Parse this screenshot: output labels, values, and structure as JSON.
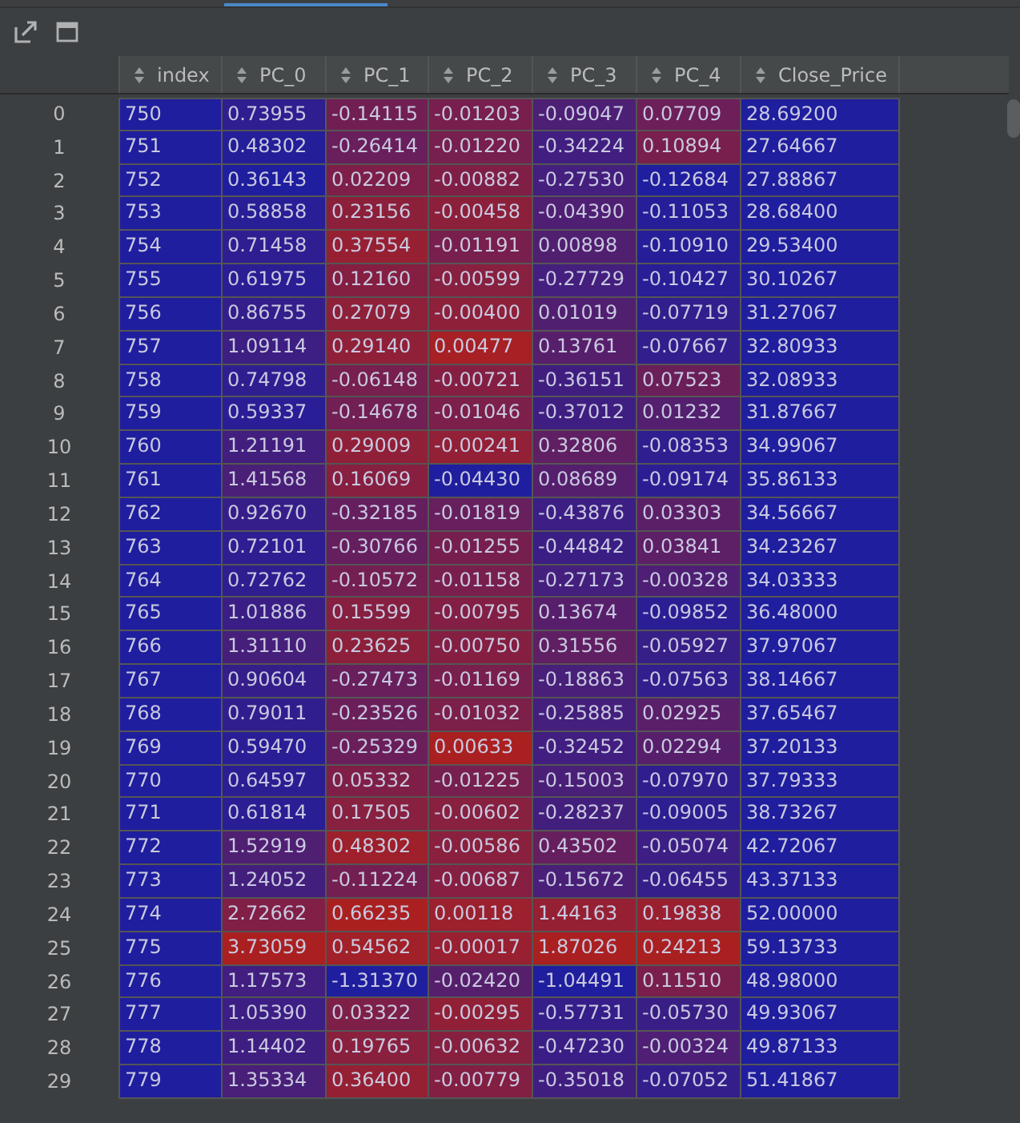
{
  "columns": [
    {
      "label": "index",
      "heatmap": false
    },
    {
      "label": "PC_0",
      "heatmap": true
    },
    {
      "label": "PC_1",
      "heatmap": true
    },
    {
      "label": "PC_2",
      "heatmap": true
    },
    {
      "label": "PC_3",
      "heatmap": true
    },
    {
      "label": "PC_4",
      "heatmap": true
    },
    {
      "label": "Close_Price",
      "heatmap": false
    }
  ],
  "rows": [
    {
      "label": "0",
      "cells": [
        "750",
        "0.73955",
        "-0.14115",
        "-0.01203",
        "-0.09047",
        "0.07709",
        "28.69200"
      ]
    },
    {
      "label": "1",
      "cells": [
        "751",
        "0.48302",
        "-0.26414",
        "-0.01220",
        "-0.34224",
        "0.10894",
        "27.64667"
      ]
    },
    {
      "label": "2",
      "cells": [
        "752",
        "0.36143",
        "0.02209",
        "-0.00882",
        "-0.27530",
        "-0.12684",
        "27.88867"
      ]
    },
    {
      "label": "3",
      "cells": [
        "753",
        "0.58858",
        "0.23156",
        "-0.00458",
        "-0.04390",
        "-0.11053",
        "28.68400"
      ]
    },
    {
      "label": "4",
      "cells": [
        "754",
        "0.71458",
        "0.37554",
        "-0.01191",
        "0.00898",
        "-0.10910",
        "29.53400"
      ]
    },
    {
      "label": "5",
      "cells": [
        "755",
        "0.61975",
        "0.12160",
        "-0.00599",
        "-0.27729",
        "-0.10427",
        "30.10267"
      ]
    },
    {
      "label": "6",
      "cells": [
        "756",
        "0.86755",
        "0.27079",
        "-0.00400",
        "0.01019",
        "-0.07719",
        "31.27067"
      ]
    },
    {
      "label": "7",
      "cells": [
        "757",
        "1.09114",
        "0.29140",
        "0.00477",
        "0.13761",
        "-0.07667",
        "32.80933"
      ]
    },
    {
      "label": "8",
      "cells": [
        "758",
        "0.74798",
        "-0.06148",
        "-0.00721",
        "-0.36151",
        "0.07523",
        "32.08933"
      ]
    },
    {
      "label": "9",
      "cells": [
        "759",
        "0.59337",
        "-0.14678",
        "-0.01046",
        "-0.37012",
        "0.01232",
        "31.87667"
      ]
    },
    {
      "label": "10",
      "cells": [
        "760",
        "1.21191",
        "0.29009",
        "-0.00241",
        "0.32806",
        "-0.08353",
        "34.99067"
      ]
    },
    {
      "label": "11",
      "cells": [
        "761",
        "1.41568",
        "0.16069",
        "-0.04430",
        "0.08689",
        "-0.09174",
        "35.86133"
      ]
    },
    {
      "label": "12",
      "cells": [
        "762",
        "0.92670",
        "-0.32185",
        "-0.01819",
        "-0.43876",
        "0.03303",
        "34.56667"
      ]
    },
    {
      "label": "13",
      "cells": [
        "763",
        "0.72101",
        "-0.30766",
        "-0.01255",
        "-0.44842",
        "0.03841",
        "34.23267"
      ]
    },
    {
      "label": "14",
      "cells": [
        "764",
        "0.72762",
        "-0.10572",
        "-0.01158",
        "-0.27173",
        "-0.00328",
        "34.03333"
      ]
    },
    {
      "label": "15",
      "cells": [
        "765",
        "1.01886",
        "0.15599",
        "-0.00795",
        "0.13674",
        "-0.09852",
        "36.48000"
      ]
    },
    {
      "label": "16",
      "cells": [
        "766",
        "1.31110",
        "0.23625",
        "-0.00750",
        "0.31556",
        "-0.05927",
        "37.97067"
      ]
    },
    {
      "label": "17",
      "cells": [
        "767",
        "0.90604",
        "-0.27473",
        "-0.01169",
        "-0.18863",
        "-0.07563",
        "38.14667"
      ]
    },
    {
      "label": "18",
      "cells": [
        "768",
        "0.79011",
        "-0.23526",
        "-0.01032",
        "-0.25885",
        "0.02925",
        "37.65467"
      ]
    },
    {
      "label": "19",
      "cells": [
        "769",
        "0.59470",
        "-0.25329",
        "0.00633",
        "-0.32452",
        "0.02294",
        "37.20133"
      ]
    },
    {
      "label": "20",
      "cells": [
        "770",
        "0.64597",
        "0.05332",
        "-0.01225",
        "-0.15003",
        "-0.07970",
        "37.79333"
      ]
    },
    {
      "label": "21",
      "cells": [
        "771",
        "0.61814",
        "0.17505",
        "-0.00602",
        "-0.28237",
        "-0.09005",
        "38.73267"
      ]
    },
    {
      "label": "22",
      "cells": [
        "772",
        "1.52919",
        "0.48302",
        "-0.00586",
        "0.43502",
        "-0.05074",
        "42.72067"
      ]
    },
    {
      "label": "23",
      "cells": [
        "773",
        "1.24052",
        "-0.11224",
        "-0.00687",
        "-0.15672",
        "-0.06455",
        "43.37133"
      ]
    },
    {
      "label": "24",
      "cells": [
        "774",
        "2.72662",
        "0.66235",
        "0.00118",
        "1.44163",
        "0.19838",
        "52.00000"
      ]
    },
    {
      "label": "25",
      "cells": [
        "775",
        "3.73059",
        "0.54562",
        "-0.00017",
        "1.87026",
        "0.24213",
        "59.13733"
      ]
    },
    {
      "label": "26",
      "cells": [
        "776",
        "1.17573",
        "-1.31370",
        "-0.02420",
        "-1.04491",
        "0.11510",
        "48.98000"
      ]
    },
    {
      "label": "27",
      "cells": [
        "777",
        "1.05390",
        "0.03322",
        "-0.00295",
        "-0.57731",
        "-0.05730",
        "49.93067"
      ]
    },
    {
      "label": "28",
      "cells": [
        "778",
        "1.14402",
        "0.19765",
        "-0.00632",
        "-0.47230",
        "-0.00324",
        "49.87133"
      ]
    },
    {
      "label": "29",
      "cells": [
        "779",
        "1.35334",
        "0.36400",
        "-0.00779",
        "-0.35018",
        "-0.07052",
        "51.41867"
      ]
    }
  ]
}
